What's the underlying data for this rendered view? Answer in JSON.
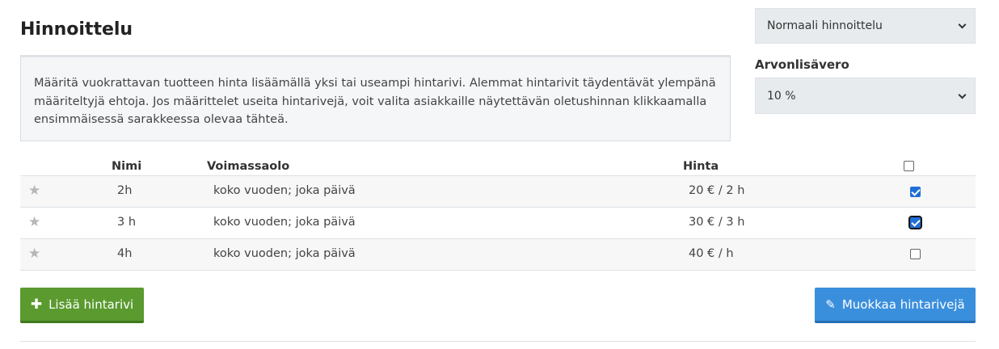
{
  "page": {
    "title": "Hinnoittelu"
  },
  "pricing_select": {
    "value": "Normaali hinnoittelu"
  },
  "vat": {
    "label": "Arvonlisävero",
    "value": "10 %"
  },
  "info_text": "Määritä vuokrattavan tuotteen hinta lisäämällä yksi tai useampi hintarivi. Alemmat hintarivit täydentävät ylempänä määriteltyjä ehtoja. Jos määrittelet useita hintarivejä, voit valita asiakkaille näytettävän oletushinnan klikkaamalla ensimmäisessä sarakkeessa olevaa tähteä.",
  "table": {
    "headers": {
      "name": "Nimi",
      "validity": "Voimassaolo",
      "price": "Hinta"
    },
    "rows": [
      {
        "name": "2h",
        "validity": "koko vuoden; joka päivä",
        "price": "20 € / 2 h",
        "checked": true
      },
      {
        "name": "3 h",
        "validity": "koko vuoden; joka päivä",
        "price": "30 € / 3 h",
        "checked": true
      },
      {
        "name": "4h",
        "validity": "koko vuoden; joka päivä",
        "price": "40 € / h",
        "checked": false
      }
    ]
  },
  "buttons": {
    "add": "Lisää hintarivi",
    "edit": "Muokkaa hintarivejä"
  },
  "icons": {
    "star": "star-icon",
    "plus": "plus-icon",
    "pencil": "pencil-icon",
    "chevron": "chevron-down-icon"
  },
  "colors": {
    "add_button": "#5a9a2f",
    "edit_button": "#3a8fdd",
    "checkbox_checked": "#1f6fd6"
  }
}
